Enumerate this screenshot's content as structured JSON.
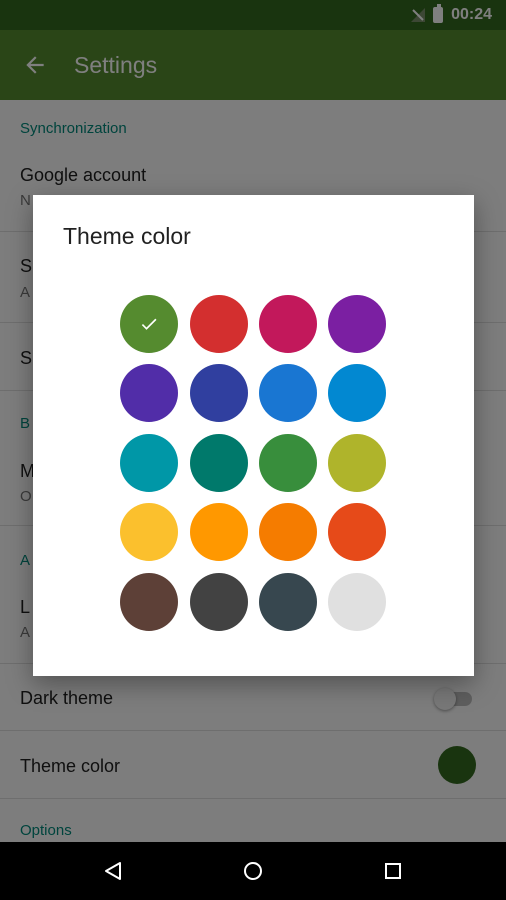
{
  "status_bar": {
    "time": "00:24",
    "icons": [
      "no-signal-icon",
      "battery-icon"
    ]
  },
  "app_bar": {
    "title": "Settings",
    "back_icon": "arrow-back-icon"
  },
  "settings": {
    "sync_category": "Synchronization",
    "google_account_title": "Google account",
    "google_account_sub": "N",
    "row2_title": "S",
    "row2_sub": "A",
    "row3_title": "S",
    "category2": "B",
    "row4_title": "M",
    "row4_sub": "O",
    "category3": "A",
    "row5_title": "L",
    "row5_sub": "A",
    "dark_theme_title": "Dark theme",
    "dark_theme_on": false,
    "theme_color_title": "Theme color",
    "theme_color_value": "#33691e",
    "options_category": "Options"
  },
  "dialog": {
    "title": "Theme color",
    "selected_index": 0,
    "colors": [
      "#558b2f",
      "#d32f2f",
      "#c2185b",
      "#7b1fa2",
      "#512da8",
      "#303f9f",
      "#1976d2",
      "#0288d1",
      "#0097a7",
      "#00796b",
      "#388e3c",
      "#afb42b",
      "#fbc02d",
      "#ff9800",
      "#f57c00",
      "#e64a19",
      "#5d4037",
      "#424242",
      "#37474f",
      "#e0e0e0"
    ]
  },
  "nav_bar": {
    "buttons": [
      "back-triangle-icon",
      "home-circle-icon",
      "recents-square-icon"
    ]
  }
}
